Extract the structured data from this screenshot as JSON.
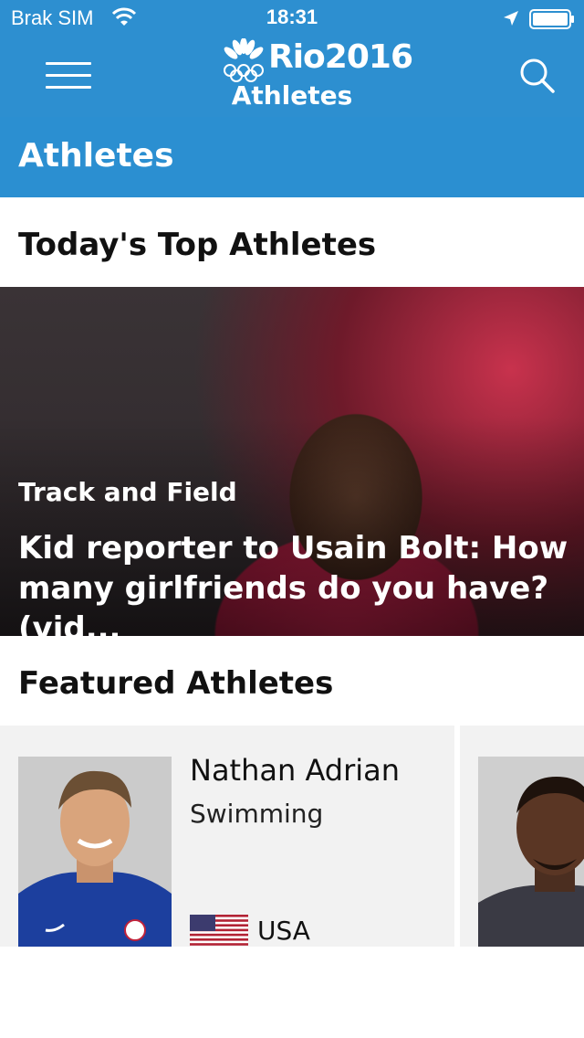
{
  "status": {
    "carrier": "Brak SIM",
    "time": "18:31"
  },
  "header": {
    "brand": "Rio2016",
    "subtitle": "Athletes"
  },
  "page_title": "Athletes",
  "sections": {
    "top": "Today's Top Athletes",
    "featured": "Featured Athletes"
  },
  "hero": {
    "sport": "Track and Field",
    "headline": "Kid reporter to Usain Bolt: How many girlfriends do you have? (vid..."
  },
  "featured": [
    {
      "name": "Nathan Adrian",
      "sport": "Swimming",
      "country": "USA"
    }
  ],
  "colors": {
    "header_blue": "#2d8fd0",
    "section_blue": "#2b8fd1",
    "card_bg": "#f2f2f2"
  }
}
